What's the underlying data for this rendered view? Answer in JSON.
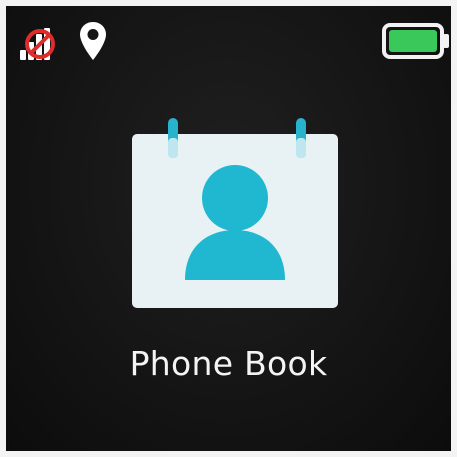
{
  "status_bar": {
    "signal_icon": "signal-no-sim-icon",
    "location_icon": "location-pin-icon",
    "battery_icon": "battery-full-icon",
    "battery_color": "#3ac85a"
  },
  "main": {
    "app_icon": "phone-book-icon",
    "app_label": "Phone Book",
    "accent_color": "#22b8cf"
  }
}
